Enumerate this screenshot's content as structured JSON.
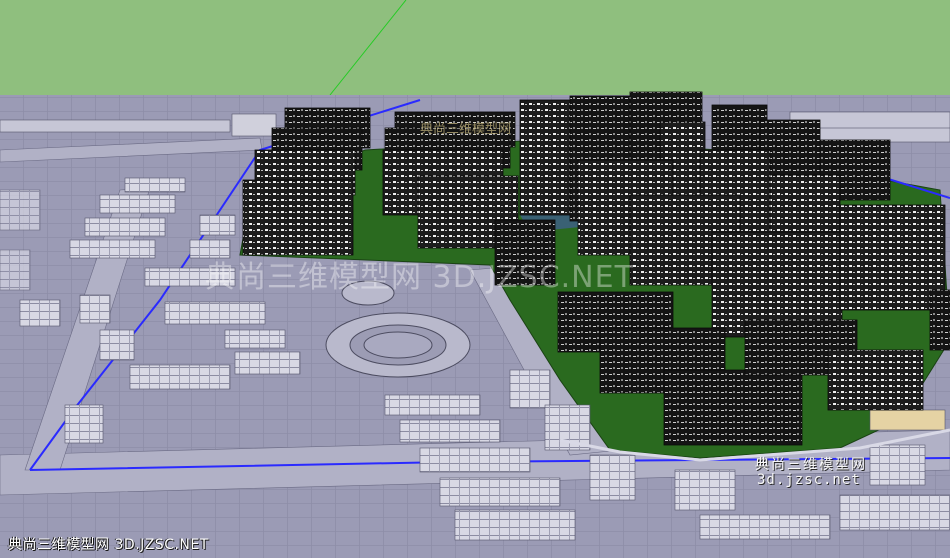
{
  "viewport": {
    "description_label": "SketchUp 3D model view",
    "sky_color": "#8fbf7e",
    "ground_color": "#9a9ab4",
    "grass_color": "#2a6a1f",
    "axis_color": "#22cc22",
    "boundary_color": "#2a2aff"
  },
  "watermarks": {
    "center": "典尚三维模型网 3D.JZSC.NET",
    "top": "典尚三维模型网",
    "bottom_right_cn": "典尚三维模型网",
    "bottom_right_url": "3d.jzsc.net",
    "bottom_left": "典尚三维模型网 3D.JZSC.NET"
  }
}
